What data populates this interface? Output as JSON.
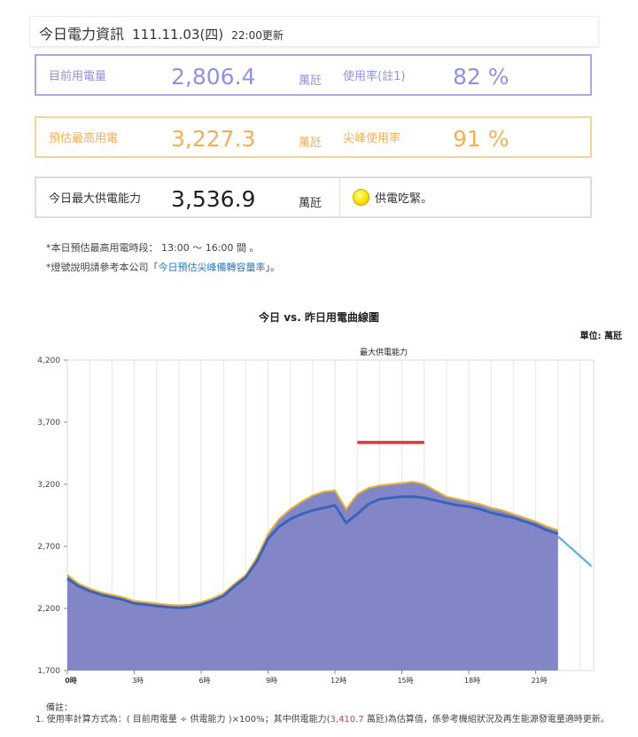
{
  "header": {
    "title": "今日電力資訊",
    "date": "111.11.03(四)",
    "updated": "22:00更新"
  },
  "current": {
    "label": "目前用電量",
    "value": "2,806.4",
    "unit": "萬瓩",
    "rate_label": "使用率(註1)",
    "rate": "82 %"
  },
  "forecast": {
    "label": "預估最高用電",
    "value": "3,227.3",
    "unit": "萬瓩",
    "rate_label": "尖峰使用率",
    "rate": "91 %"
  },
  "capacity": {
    "label": "今日最大供電能力",
    "value": "3,536.9",
    "unit": "萬瓩",
    "status": "供電吃緊",
    "status_suffix": "。",
    "status_color": "#f6e000"
  },
  "notes": {
    "line1": "*本日預估最高用電時段： 13:00 ～ 16:00 間 。",
    "line2_prefix": "*燈號說明請參考本公司「",
    "line2_link": "今日預估尖峰備轉容量率",
    "line2_suffix": "」。"
  },
  "footnote": {
    "title": "備註：",
    "text_prefix": "1. 使用率計算方式為：( 目前用電量 ÷ 供電能力 )×100%；其中供電能力(",
    "text_value": "3,410.7",
    "text_suffix": " 萬瓩)為估算值，係參考機組狀況及再生能源發電量適時更新。"
  },
  "chart_data": {
    "type": "area",
    "title": "今日 vs. 昨日用電曲線圖",
    "unit_label": "單位: 萬瓩",
    "max_capacity_label": "最大供電能力",
    "xlabel": "",
    "ylabel": "",
    "xlim": [
      0,
      23.6
    ],
    "ylim": [
      1700,
      4200
    ],
    "y_ticks": [
      1700,
      2200,
      2700,
      3200,
      3700,
      4200
    ],
    "y_tick_labels": [
      "1,700",
      "2,200",
      "2,700",
      "3,200",
      "3,700",
      "4,200"
    ],
    "x_ticks": [
      0,
      3,
      6,
      9,
      12,
      15,
      18,
      21
    ],
    "x_tick_labels": [
      "0時",
      "3時",
      "6時",
      "9時",
      "12時",
      "15時",
      "18時",
      "21時"
    ],
    "grid": true,
    "colors": {
      "area_fill": "#7b7fc4",
      "forecast_line": "#e7b43a",
      "today_line": "#3c63b8",
      "yesterday_line": "#6ab5dd",
      "capacity_line": "#d63a3a"
    },
    "capacity_segment": {
      "x": [
        13,
        16
      ],
      "y": 3537
    },
    "series": [
      {
        "name": "",
        "role": "today_actual",
        "x": [
          0,
          0.5,
          1,
          1.5,
          2,
          2.5,
          3,
          3.5,
          4,
          4.5,
          5,
          5.5,
          6,
          6.5,
          7,
          7.5,
          8,
          8.5,
          9,
          9.5,
          10,
          10.5,
          11,
          11.5,
          12,
          12.5,
          13,
          13.5,
          14,
          14.5,
          15,
          15.5,
          16,
          16.5,
          17,
          17.5,
          18,
          18.5,
          19,
          19.5,
          20,
          20.5,
          21,
          21.5,
          22
        ],
        "y": [
          2440,
          2380,
          2340,
          2310,
          2290,
          2270,
          2240,
          2230,
          2220,
          2210,
          2205,
          2210,
          2230,
          2260,
          2300,
          2380,
          2450,
          2580,
          2760,
          2860,
          2920,
          2960,
          2990,
          3010,
          3030,
          2890,
          2960,
          3040,
          3080,
          3090,
          3100,
          3100,
          3090,
          3070,
          3050,
          3030,
          3020,
          3000,
          2970,
          2950,
          2930,
          2900,
          2870,
          2830,
          2800
        ]
      },
      {
        "name": "",
        "role": "today_forecast",
        "x": [
          0,
          0.5,
          1,
          1.5,
          2,
          2.5,
          3,
          3.5,
          4,
          4.5,
          5,
          5.5,
          6,
          6.5,
          7,
          7.5,
          8,
          8.5,
          9,
          9.5,
          10,
          10.5,
          11,
          11.5,
          12,
          12.5,
          13,
          13.5,
          14,
          14.5,
          15,
          15.5,
          16,
          16.5,
          17,
          17.5,
          18,
          18.5,
          19,
          19.5,
          20,
          20.5,
          21,
          21.5,
          22
        ],
        "y": [
          2470,
          2400,
          2360,
          2330,
          2310,
          2290,
          2260,
          2250,
          2240,
          2230,
          2225,
          2230,
          2250,
          2280,
          2320,
          2400,
          2470,
          2610,
          2800,
          2920,
          3000,
          3060,
          3110,
          3140,
          3150,
          3000,
          3120,
          3170,
          3190,
          3200,
          3210,
          3220,
          3200,
          3150,
          3100,
          3080,
          3060,
          3040,
          3010,
          2990,
          2960,
          2930,
          2900,
          2860,
          2830
        ]
      },
      {
        "name": "",
        "role": "yesterday_tail",
        "x": [
          22,
          22.5,
          23,
          23.5
        ],
        "y": [
          2780,
          2700,
          2620,
          2540
        ]
      }
    ]
  }
}
